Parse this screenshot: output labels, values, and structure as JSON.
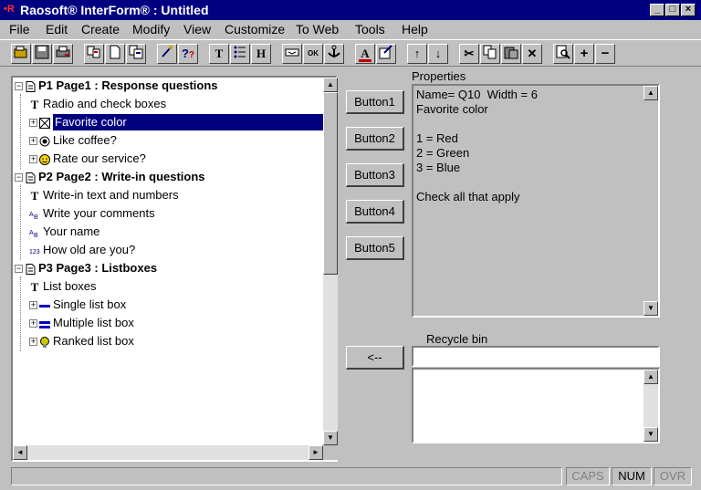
{
  "window": {
    "title": "Raosoft® InterForm® : Untitled",
    "controls": {
      "minimize": "_",
      "maximize": "□",
      "close": "×"
    }
  },
  "menu": [
    "File",
    "Edit",
    "Create",
    "Modify",
    "View",
    "Customize",
    "To Web",
    "Tools",
    "Help"
  ],
  "toolbar": {
    "icons": [
      "open-icon",
      "save-icon",
      "print-icon",
      "pages-icon",
      "new-page-icon",
      "page-view-icon",
      "wizard-icon",
      "query-icon",
      "text-icon",
      "list-icon",
      "heading-icon",
      "field-icon",
      "ok-button-icon",
      "anchor-icon",
      "font-color-icon",
      "properties-icon",
      "up-arrow-icon",
      "down-arrow-icon",
      "cut-icon",
      "copy-icon",
      "paste-icon",
      "delete-icon",
      "preview-icon",
      "expand-icon",
      "collapse-icon"
    ],
    "glyphs": {
      "text": "T",
      "heading": "H",
      "up": "↑",
      "down": "↓",
      "cut": "✂",
      "delete": "✕",
      "ok": "OK",
      "expand": "+",
      "collapse": "−"
    }
  },
  "tree": {
    "rows": [
      {
        "label": "P1 Page1 : Response questions",
        "bold": true,
        "level": 0,
        "icon": "page",
        "expander": "−"
      },
      {
        "label": "Radio and check boxes",
        "bold": false,
        "level": 1,
        "icon": "T",
        "expander": ""
      },
      {
        "label": "Favorite color",
        "bold": false,
        "level": 1,
        "icon": "checkbox",
        "expander": "+",
        "selected": true
      },
      {
        "label": "Like coffee?",
        "bold": false,
        "level": 1,
        "icon": "radio",
        "expander": "+"
      },
      {
        "label": "Rate our service?",
        "bold": false,
        "level": 1,
        "icon": "smiley",
        "expander": "+"
      },
      {
        "label": "P2 Page2 : Write-in questions",
        "bold": true,
        "level": 0,
        "icon": "page",
        "expander": "−"
      },
      {
        "label": "Write-in text and numbers",
        "bold": false,
        "level": 1,
        "icon": "T",
        "expander": ""
      },
      {
        "label": "Write your comments",
        "bold": false,
        "level": 1,
        "icon": "ab",
        "expander": ""
      },
      {
        "label": "Your name",
        "bold": false,
        "level": 1,
        "icon": "ab",
        "expander": ""
      },
      {
        "label": "How old are you?",
        "bold": false,
        "level": 1,
        "icon": "123",
        "expander": ""
      },
      {
        "label": "P3 Page3 : Listboxes",
        "bold": true,
        "level": 0,
        "icon": "page",
        "expander": "−"
      },
      {
        "label": "List boxes",
        "bold": false,
        "level": 1,
        "icon": "T",
        "expander": ""
      },
      {
        "label": "Single list box",
        "bold": false,
        "level": 1,
        "icon": "single-line",
        "expander": "+"
      },
      {
        "label": "Multiple list box",
        "bold": false,
        "level": 1,
        "icon": "double-line",
        "expander": "+"
      },
      {
        "label": "Ranked list box",
        "bold": false,
        "level": 1,
        "icon": "ranked",
        "expander": "+"
      }
    ]
  },
  "buttons": {
    "b1": "Button1",
    "b2": "Button2",
    "b3": "Button3",
    "b4": "Button4",
    "b5": "Button5",
    "move": "<--"
  },
  "properties": {
    "label": "Properties",
    "text": "Name= Q10  Width = 6\nFavorite color\n\n1 = Red\n2 = Green\n3 = Blue\n\nCheck all that apply"
  },
  "recycle": {
    "label": "Recycle bin",
    "input_value": ""
  },
  "status": {
    "caps": "CAPS",
    "num": "NUM",
    "ovr": "OVR"
  }
}
